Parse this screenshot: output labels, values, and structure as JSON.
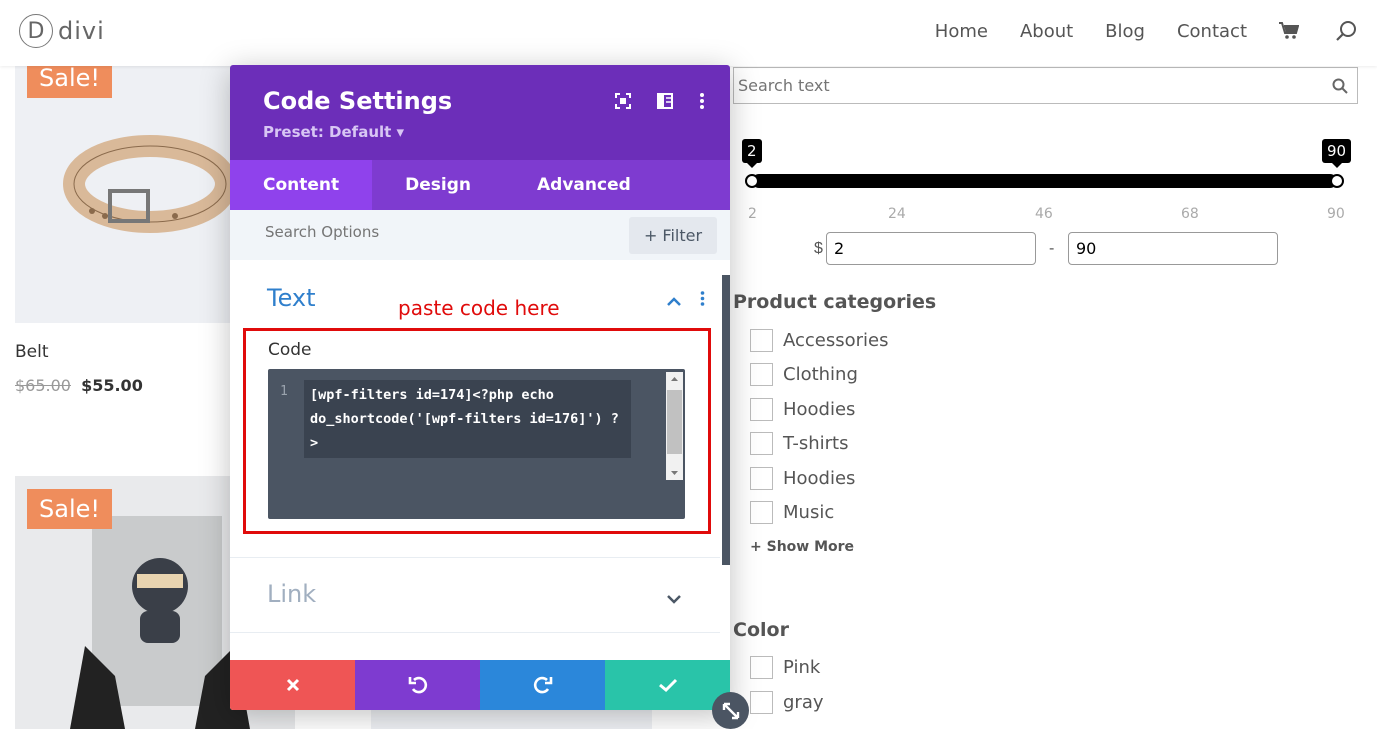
{
  "header": {
    "logo_letter": "D",
    "logo_text": "divi",
    "nav": [
      "Home",
      "About",
      "Blog",
      "Contact"
    ],
    "cart_icon": "cart-icon",
    "search_icon": "search-icon"
  },
  "products": [
    {
      "badge": "Sale!",
      "name": "Belt",
      "old_price": "$65.00",
      "new_price": "$55.00"
    },
    {
      "badge": "Sale!"
    }
  ],
  "filters": {
    "search_placeholder": "Search text",
    "price": {
      "min_tip": "2",
      "max_tip": "90",
      "ticks": [
        "2",
        "24",
        "46",
        "68",
        "90"
      ],
      "currency": "$",
      "min_value": "2",
      "max_value": "90",
      "dash": "-"
    },
    "categories_heading": "Product categories",
    "categories": [
      "Accessories",
      "Clothing",
      "Hoodies",
      "T-shirts",
      "Hoodies",
      "Music"
    ],
    "show_more": "+ Show More",
    "color_heading": "Color",
    "colors": [
      "Pink",
      "gray"
    ]
  },
  "modal": {
    "title": "Code Settings",
    "preset": "Preset: Default ▾",
    "tabs": [
      "Content",
      "Design",
      "Advanced"
    ],
    "active_tab": "Content",
    "search_placeholder": "Search Options",
    "filter_label": "+ Filter",
    "section_text": "Text",
    "annotation": "paste code here",
    "code_label": "Code",
    "line_number": "1",
    "code": "[wpf-filters id=174]<?php echo do_shortcode('[wpf-filters id=176]') ?>",
    "section_link": "Link",
    "footer_colors": {
      "cancel": "#ef5555",
      "undo": "#7e3bd0",
      "redo": "#2b87da",
      "save": "#29c4a9"
    }
  },
  "colors": {
    "purple_dark": "#6c2eb9",
    "purple_tab": "#7e3bd0",
    "sale_orange": "#ef8d5c",
    "annotation_red": "#e00b0b"
  }
}
